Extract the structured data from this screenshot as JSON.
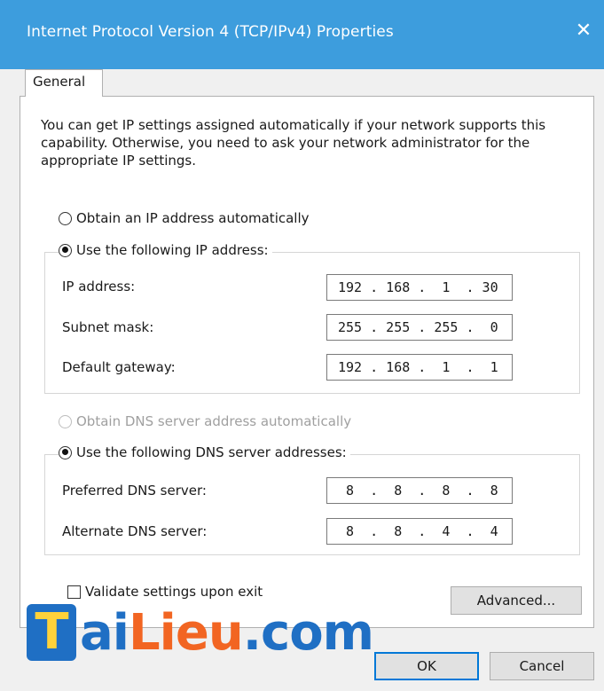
{
  "window": {
    "title": "Internet Protocol Version 4 (TCP/IPv4) Properties",
    "close_glyph": "✕"
  },
  "tabs": [
    {
      "label": "General"
    }
  ],
  "intro_text": "You can get IP settings assigned automatically if your network supports this capability. Otherwise, you need to ask your network administrator for the appropriate IP settings.",
  "ip": {
    "auto_label": "Obtain an IP address automatically",
    "auto_selected": false,
    "manual_label": "Use the following IP address:",
    "manual_selected": true,
    "fields": [
      {
        "label": "IP address:",
        "value": "192 . 168 .  1  . 30"
      },
      {
        "label": "Subnet mask:",
        "value": "255 . 255 . 255 .  0"
      },
      {
        "label": "Default gateway:",
        "value": "192 . 168 .  1  .  1"
      }
    ]
  },
  "dns": {
    "auto_label": "Obtain DNS server address automatically",
    "auto_enabled": false,
    "manual_label": "Use the following DNS server addresses:",
    "manual_selected": true,
    "fields": [
      {
        "label": "Preferred DNS server:",
        "value": " 8  .  8  .  8  .  8"
      },
      {
        "label": "Alternate DNS server:",
        "value": " 8  .  8  .  4  .  4"
      }
    ]
  },
  "validate": {
    "label": "Validate settings upon exit",
    "checked": false
  },
  "buttons": {
    "advanced": "Advanced...",
    "ok": "OK",
    "cancel": "Cancel"
  },
  "watermark": {
    "t": "T",
    "ai": "ai",
    "lieu": "Lieu",
    "dot_com": ".com"
  },
  "colors": {
    "titlebar": "#3d9ddd",
    "accent": "#0078d7",
    "logo_blue": "#1f6fc4",
    "logo_orange": "#f26522"
  }
}
